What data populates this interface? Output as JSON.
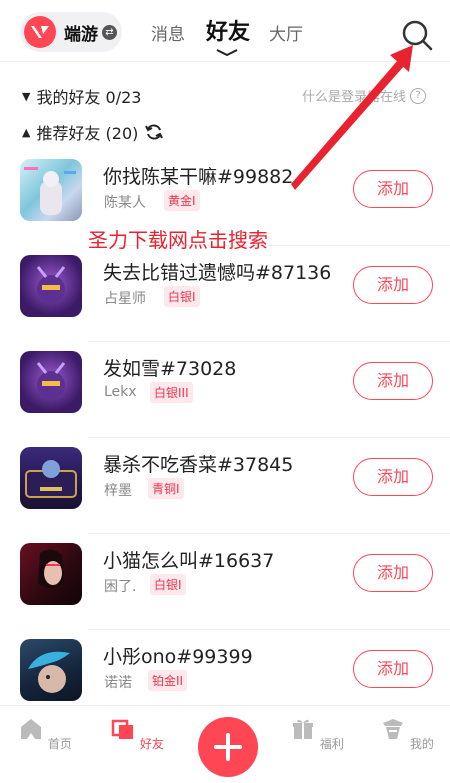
{
  "header": {
    "brand_name": "端游",
    "tabs": [
      {
        "label": "消息"
      },
      {
        "label": "好友"
      },
      {
        "label": "大厅"
      }
    ]
  },
  "sections": {
    "my_friends": "我的好友 0/23",
    "recommended": "推荐好友 (20)",
    "online_hint": "什么是登录器在线"
  },
  "overlay_text": "圣力下载网点击搜索",
  "add_label": "添加",
  "friends": [
    {
      "name": "你找陈某干嘛#99882",
      "sub": "陈某人",
      "rank": "黄金I"
    },
    {
      "name": "失去比错过遗憾吗#87136",
      "sub": "占星师",
      "rank": "白银I"
    },
    {
      "name": "发如雪#73028",
      "sub": "Lekx",
      "rank": "白银III"
    },
    {
      "name": "暴杀不吃香菜#37845",
      "sub": "梓墨",
      "rank": "青铜I"
    },
    {
      "name": "小猫怎么叫#16637",
      "sub": "困了.",
      "rank": "白银I"
    },
    {
      "name": "小彤ono#99399",
      "sub": "诺诺",
      "rank": "铂金II"
    }
  ],
  "bottom_nav": {
    "home": "首页",
    "friends": "好友",
    "welfare": "福利",
    "mine": "我的"
  },
  "colors": {
    "accent": "#ff4655",
    "annotation": "#e8222f"
  }
}
